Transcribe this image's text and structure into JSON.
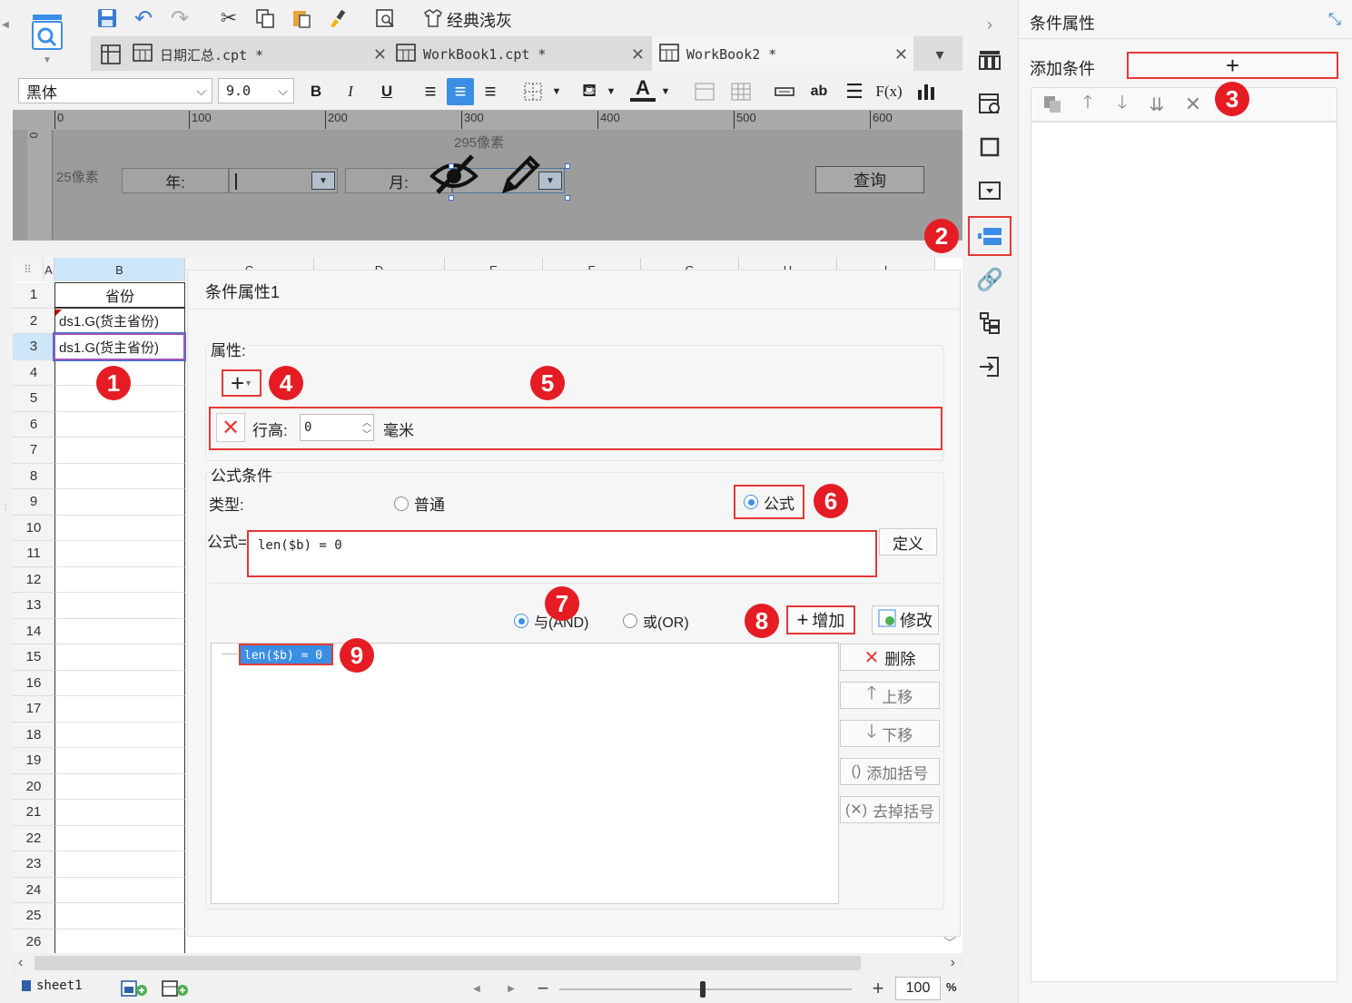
{
  "toolbar": {
    "skin_label": "经典浅灰"
  },
  "tabs": [
    {
      "label": "日期汇总.cpt *"
    },
    {
      "label": "WorkBook1.cpt *"
    },
    {
      "label": "WorkBook2 *"
    }
  ],
  "format": {
    "font": "黑体",
    "size": "9.0"
  },
  "ruler": {
    "ticks": [
      "0",
      "100",
      "200",
      "300",
      "400",
      "500",
      "600"
    ],
    "vertical": "0"
  },
  "param_panel": {
    "width_label": "295像素",
    "height_label": "25像素",
    "year_label": "年:",
    "month_label": "月:",
    "query_label": "查询"
  },
  "sheet": {
    "columns": [
      "A",
      "B",
      "C",
      "D",
      "E",
      "F",
      "G",
      "H",
      "I"
    ],
    "rows": [
      "1",
      "2",
      "3",
      "4",
      "5",
      "6",
      "7",
      "8",
      "9",
      "10",
      "11",
      "12",
      "13",
      "14",
      "15",
      "16",
      "17",
      "18",
      "19",
      "20",
      "21",
      "22",
      "23",
      "24",
      "25",
      "26"
    ],
    "b1": "省份",
    "b2": "ds1.G(货主省份)",
    "b3": "ds1.G(货主省份)",
    "sheet_name": "sheet1",
    "zoom": "100",
    "zoom_unit": "%"
  },
  "dialog": {
    "title": "条件属性1",
    "attr_label": "属性:",
    "row_height_label": "行高:",
    "row_height_value": "0",
    "unit": "毫米",
    "formula_section": "公式条件",
    "type_label": "类型:",
    "radio_normal": "普通",
    "radio_formula": "公式",
    "formula_label": "公式=",
    "formula_value": "len($b) = 0",
    "define_btn": "定义",
    "and_label": "与(AND)",
    "or_label": "或(OR)",
    "add_btn": "增加",
    "modify_btn": "修改",
    "list_item": "len($b) = 0",
    "delete_btn": "删除",
    "up_btn": "上移",
    "down_btn": "下移",
    "add_paren_btn": "添加括号",
    "remove_paren_btn": "去掉括号"
  },
  "right_panel": {
    "title": "条件属性",
    "add_condition": "添加条件"
  },
  "badges": [
    "1",
    "2",
    "3",
    "4",
    "5",
    "6",
    "7",
    "8",
    "9"
  ]
}
